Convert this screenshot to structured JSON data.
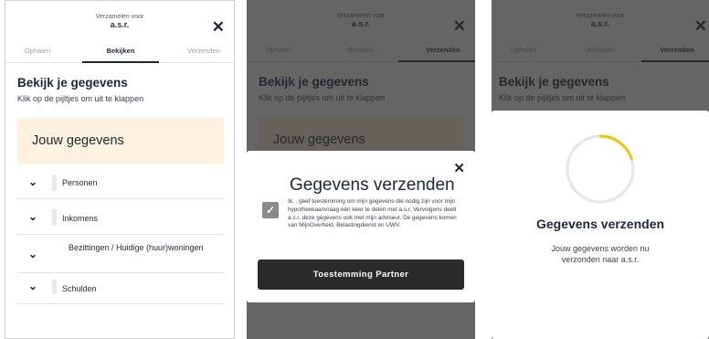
{
  "header": {
    "title": "Verzamelen voor",
    "brand": "a.s.r.",
    "tabs": [
      "Ophalen",
      "Bekijken",
      "Verzenden"
    ]
  },
  "view": {
    "heading": "Bekijk je gegevens",
    "subtitle": "Klik op de pijltjes om uit te klappen",
    "section": "Jouw gegevens",
    "rows": [
      "Personen",
      "Inkomens",
      "Bezittingen / Huidige (huur)woningen",
      "Schulden"
    ]
  },
  "send_modal": {
    "title": "Gegevens verzenden",
    "consent_text": "Ik,           , geef toestemming om mijn gegevens die nodig zijn voor mijn hypotheekaanvraag één keer te delen met a.s.r. Vervolgens deelt a.s.r. deze gegevens ook met mijn adviseur. De gegevens komen van MijnOverheid, Belastingdienst en UWV.",
    "button": "Toestemming Partner"
  },
  "sending": {
    "title": "Gegevens verzenden",
    "subtitle": "Jouw gegevens worden nu verzonden naar a.s.r.",
    "progress": 0.2
  },
  "colors": {
    "accent_yellow": "#f4c20d",
    "section_bg": "#fdf2de",
    "dark": "#1d2738",
    "button": "#2b2b2b"
  },
  "icons": {
    "close": "close-icon",
    "chevron": "chevron-down-icon",
    "checkbox": "checkbox-checked-icon",
    "spinner": "loading-spinner-icon"
  }
}
